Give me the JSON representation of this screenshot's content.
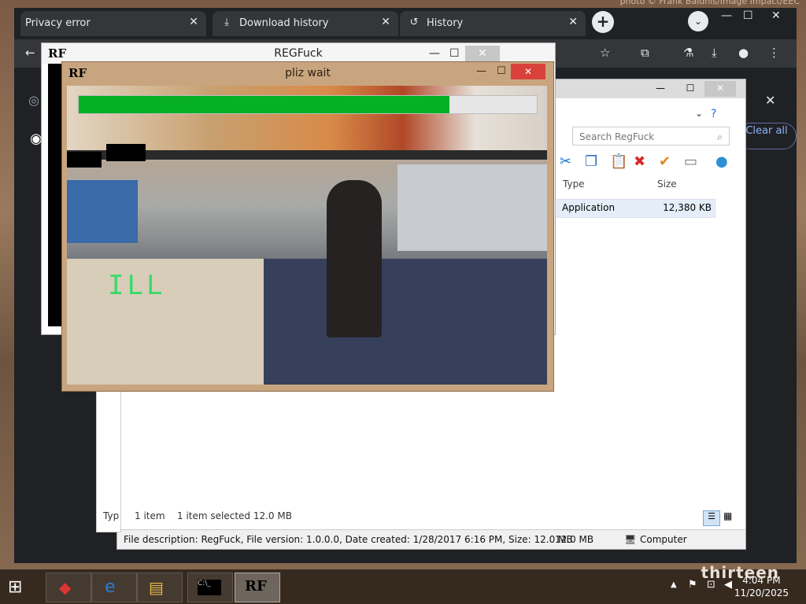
{
  "credit": "photo © Frank Baldhis/Image Impact/EEC",
  "browser": {
    "tabs": [
      {
        "label": "Privacy error",
        "icon": "warning-icon"
      },
      {
        "label": "Download history",
        "icon": "download-icon"
      },
      {
        "label": "History",
        "icon": "history-icon"
      }
    ],
    "new_tab": "+",
    "tab_search": "⌄",
    "window": {
      "minimize": "—",
      "maximize": "☐",
      "close": "✕"
    },
    "clear_all": "Clear all"
  },
  "explorer": {
    "search_placeholder": "Search RegFuck",
    "columns": [
      "Type",
      "Size"
    ],
    "row": {
      "type": "Application",
      "size": "12,380 KB"
    },
    "status": {
      "items": "1 item",
      "selected": "1 item selected  12.0 MB"
    },
    "details": {
      "description": "File description: RegFuck, File version: 1.0.0.0, Date created: 1/28/2017 6:16 PM, Size: 12.0 MB",
      "size": "12.0 MB",
      "location": "Computer"
    },
    "left_pane_label": "Typ"
  },
  "back_window": {
    "title": "REGFuck",
    "logo": "RF"
  },
  "front_window": {
    "title": "pliz wait",
    "logo": "RF",
    "progress": 0.81,
    "overlay_text": "ILL"
  },
  "taskbar": {
    "time": "4:04 PM",
    "date": "11/20/2025",
    "watermark": "thirteen"
  },
  "colors": {
    "progress_green": "#06b025",
    "close_red": "#d9423a",
    "window_tan": "#c9a57f",
    "chrome_dark": "#202124"
  }
}
